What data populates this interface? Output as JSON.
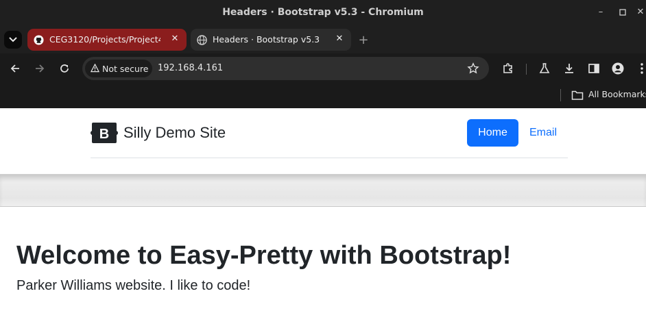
{
  "window": {
    "title": "Headers · Bootstrap v5.3 - Chromium"
  },
  "tabs": [
    {
      "label": "CEG3120/Projects/Project4",
      "icon": "github-icon",
      "active": false,
      "color": "#8b1d1d"
    },
    {
      "label": "Headers · Bootstrap v5.3",
      "icon": "globe-icon",
      "active": true
    }
  ],
  "toolbar": {
    "security_chip": "Not secure",
    "url": "192.168.4.161"
  },
  "bookmarks": {
    "label": "All Bookmarks"
  },
  "page": {
    "brand": "Silly Demo Site",
    "brand_logo_letter": "B",
    "nav": [
      {
        "label": "Home",
        "active": true
      },
      {
        "label": "Email",
        "active": false
      }
    ],
    "hero_title": "Welcome to Easy-Pretty with Bootstrap!",
    "hero_subtitle": "Parker Williams website. I like to code!",
    "accent_color": "#0d6efd"
  }
}
